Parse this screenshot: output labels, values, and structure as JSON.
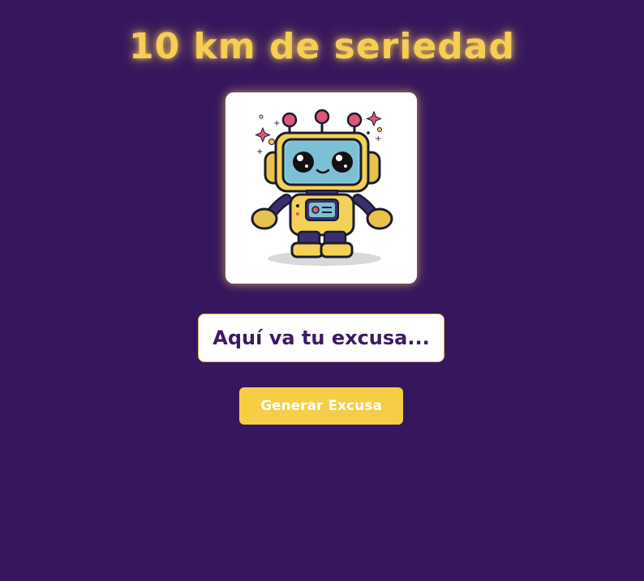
{
  "header": {
    "title": "10 km de seriedad"
  },
  "main": {
    "image": {
      "icon": "robot-illustration"
    },
    "excuse_text": "Aquí va tu excusa...",
    "generate_button_label": "Generar Excusa"
  },
  "colors": {
    "background": "#36175e",
    "accent": "#f6cd55",
    "button": "#f6cd45",
    "excuse_text": "#3b1a66"
  }
}
